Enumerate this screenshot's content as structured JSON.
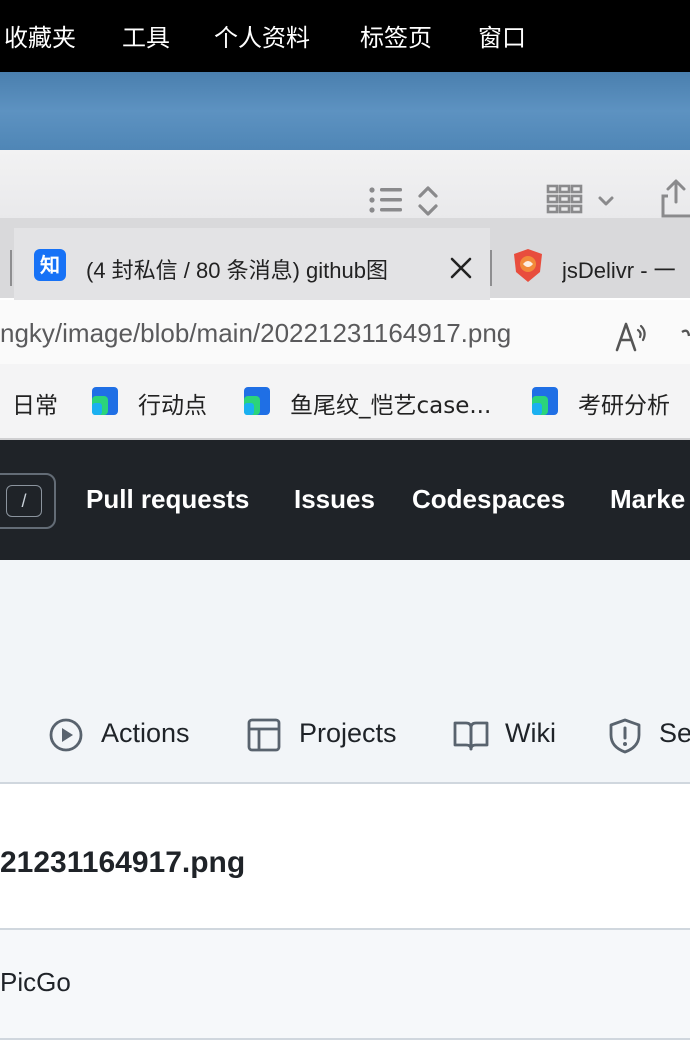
{
  "menubar": {
    "items": [
      {
        "label": "收藏夹"
      },
      {
        "label": "工具"
      },
      {
        "label": "个人资料"
      },
      {
        "label": "标签页"
      },
      {
        "label": "窗口"
      }
    ]
  },
  "tabs": {
    "active": {
      "icon_text": "知",
      "title": "(4 封私信 / 80 条消息) github图"
    },
    "next": {
      "title": "jsDelivr - 一"
    }
  },
  "address": {
    "url": "ngky/image/blob/main/20221231164917.png"
  },
  "bookmarks": {
    "items": [
      {
        "label": "日常"
      },
      {
        "label": "行动点"
      },
      {
        "label": "鱼尾纹_恺艺case..."
      },
      {
        "label": "考研分析"
      }
    ]
  },
  "github": {
    "search_key": "/",
    "nav": [
      {
        "label": "Pull requests"
      },
      {
        "label": "Issues"
      },
      {
        "label": "Codespaces"
      },
      {
        "label": "Marke"
      }
    ],
    "repo_tabs": [
      {
        "label": "Actions",
        "icon": "play-circle-icon"
      },
      {
        "label": "Projects",
        "icon": "table-icon"
      },
      {
        "label": "Wiki",
        "icon": "book-icon"
      },
      {
        "label": "Se",
        "icon": "shield-icon"
      }
    ],
    "file_title": "21231164917.png",
    "commit_author": "PicGo"
  },
  "colors": {
    "gh_header": "#1f2328",
    "repo_bg": "#f2f5f8",
    "zhihu_blue": "#1772f6",
    "jsdelivr_red": "#e84d3d"
  }
}
